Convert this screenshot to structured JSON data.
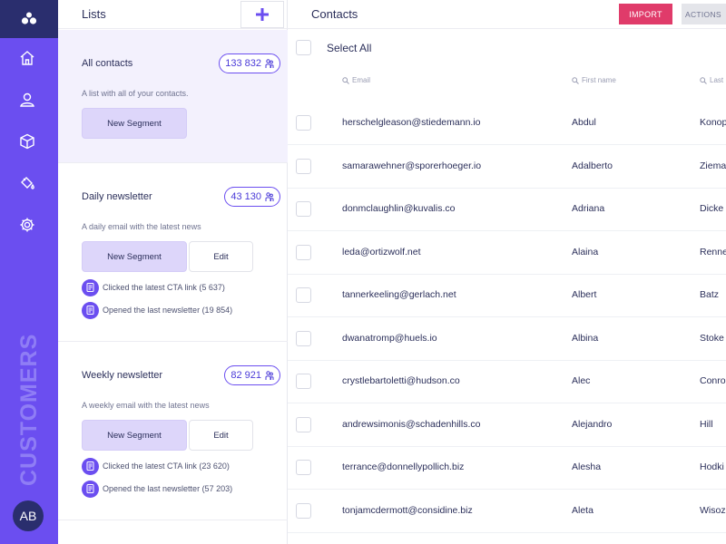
{
  "app": {
    "label": "CUSTOMERS",
    "avatar_initials": "AB",
    "accent": "#6b4ef0",
    "dark": "#2a2e6e",
    "danger": "#e03b6a"
  },
  "nav": [
    {
      "icon": "home-icon"
    },
    {
      "icon": "user-icon"
    },
    {
      "icon": "box-icon"
    },
    {
      "icon": "paint-bucket-icon"
    },
    {
      "icon": "gear-icon"
    }
  ],
  "lists": {
    "title": "Lists",
    "add_icon": "plus-icon",
    "items": [
      {
        "name": "All contacts",
        "count": "133 832",
        "description": "A list with all of your contacts.",
        "segment_label": "New Segment",
        "edit_label": "",
        "segments": []
      },
      {
        "name": "Daily newsletter",
        "count": "43 130",
        "description": "A daily email with the latest news",
        "segment_label": "New Segment",
        "edit_label": "Edit",
        "segments": [
          "Clicked the latest CTA link (5 637)",
          "Opened the last newsletter (19 854)"
        ]
      },
      {
        "name": "Weekly newsletter",
        "count": "82 921",
        "description": "A weekly email with the latest news",
        "segment_label": "New Segment",
        "edit_label": "Edit",
        "segments": [
          "Clicked the latest CTA link (23 620)",
          "Opened the last newsletter (57 203)"
        ]
      }
    ]
  },
  "contacts": {
    "title": "Contacts",
    "import_label": "IMPORT",
    "actions_label": "ACTIONS",
    "select_all_label": "Select All",
    "columns": [
      "Email",
      "First name",
      "Last"
    ],
    "rows": [
      {
        "email": "herschelgleason@stiedemann.io",
        "first": "Abdul",
        "last": "Konop"
      },
      {
        "email": "samarawehner@sporerhoeger.io",
        "first": "Adalberto",
        "last": "Ziema"
      },
      {
        "email": "donmclaughlin@kuvalis.co",
        "first": "Adriana",
        "last": "Dicke"
      },
      {
        "email": "leda@ortizwolf.net",
        "first": "Alaina",
        "last": "Renne"
      },
      {
        "email": "tannerkeeling@gerlach.net",
        "first": "Albert",
        "last": "Batz"
      },
      {
        "email": "dwanatromp@huels.io",
        "first": "Albina",
        "last": "Stoke"
      },
      {
        "email": "crystlebartoletti@hudson.co",
        "first": "Alec",
        "last": "Conro"
      },
      {
        "email": "andrewsimonis@schadenhills.co",
        "first": "Alejandro",
        "last": "Hill"
      },
      {
        "email": "terrance@donnellypollich.biz",
        "first": "Alesha",
        "last": "Hodki"
      },
      {
        "email": "tonjamcdermott@considine.biz",
        "first": "Aleta",
        "last": "Wisoz"
      }
    ]
  }
}
